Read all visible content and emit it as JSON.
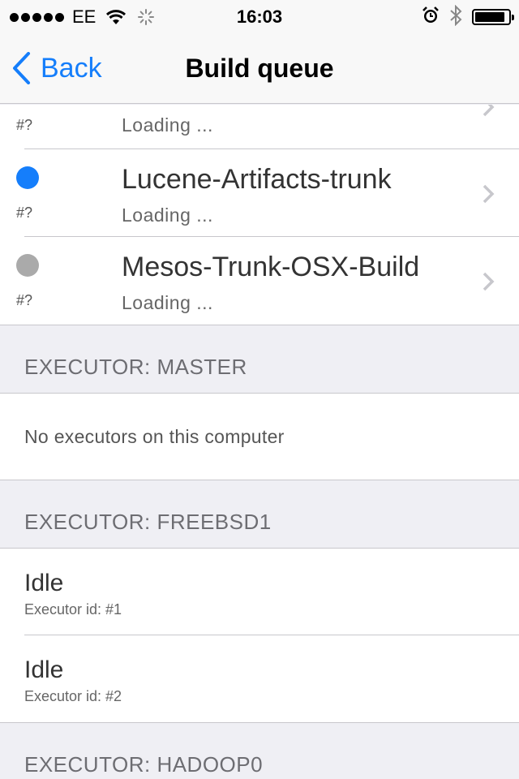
{
  "status_bar": {
    "carrier": "EE",
    "time": "16:03",
    "battery_level": 0.9
  },
  "nav": {
    "back_label": "Back",
    "title": "Build queue"
  },
  "jobs": [
    {
      "name": "",
      "build": "#?",
      "status": "Loading ...",
      "color": null,
      "partial": true
    },
    {
      "name": "Lucene-Artifacts-trunk",
      "build": "#?",
      "status": "Loading ...",
      "color": "#157efb",
      "partial": false
    },
    {
      "name": "Mesos-Trunk-OSX-Build",
      "build": "#?",
      "status": "Loading ...",
      "color": "#aaaaaa",
      "partial": false
    }
  ],
  "sections": {
    "master": {
      "header": "EXECUTOR: MASTER",
      "empty_text": "No executors on this computer"
    },
    "freebsd1": {
      "header": "EXECUTOR: FREEBSD1",
      "executors": [
        {
          "state": "Idle",
          "id_text": "Executor id: #1"
        },
        {
          "state": "Idle",
          "id_text": "Executor id: #2"
        }
      ]
    },
    "hadoop0": {
      "header": "EXECUTOR: HADOOP0"
    }
  }
}
